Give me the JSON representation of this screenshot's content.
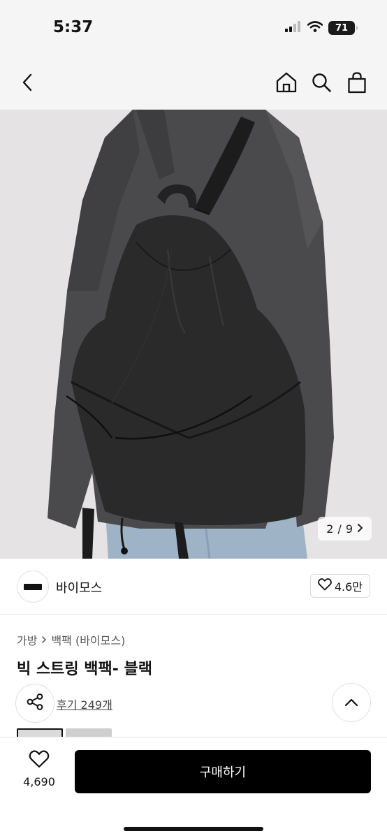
{
  "status_bar": {
    "time": "5:37",
    "battery": "71",
    "icons": [
      "signal-icon",
      "wifi-icon",
      "battery-icon"
    ]
  },
  "header": {
    "icons": [
      "back-icon",
      "home-icon",
      "search-icon",
      "shopping-bag-icon"
    ]
  },
  "gallery": {
    "current": "2",
    "separator": "/",
    "total": "9",
    "icons": [
      "chevron-right-icon"
    ]
  },
  "brand": {
    "name": "바이모스",
    "likes": "4.6만",
    "icons": [
      "heart-outline-icon"
    ]
  },
  "breadcrumb": {
    "category": "가방",
    "subcategory": "백팩 (바이모스)"
  },
  "product": {
    "title": "빅 스트링 백팩- 블랙",
    "reviews": "후기 249개"
  },
  "bottom_bar": {
    "wish_count": "4,690",
    "buy_label": "구매하기"
  },
  "colors": {
    "buy_button": "#000000",
    "image_background": "#e5e3e4",
    "bar_background": "#f5f5f5"
  }
}
